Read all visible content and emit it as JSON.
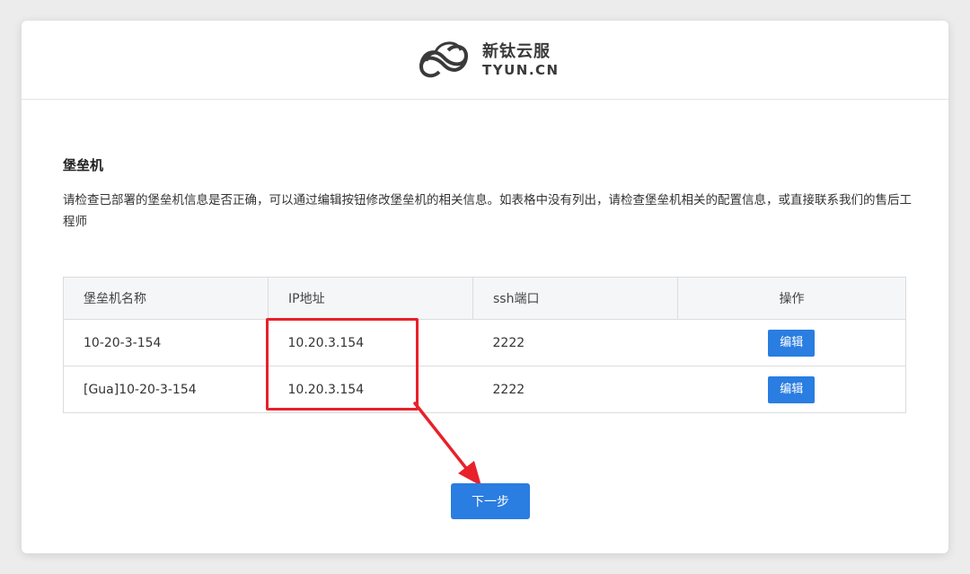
{
  "brand": {
    "name_cn": "新钛云服",
    "name_en": "TYUN.CN",
    "logo_icon": "infinity-cloud-logo-icon"
  },
  "section": {
    "title": "堡垒机",
    "description": "请检查已部署的堡垒机信息是否正确，可以通过编辑按钮修改堡垒机的相关信息。如表格中没有列出，请检查堡垒机相关的配置信息，或直接联系我们的售后工程师"
  },
  "table": {
    "headers": [
      "堡垒机名称",
      "IP地址",
      "ssh端口",
      "操作"
    ],
    "rows": [
      {
        "name": "10-20-3-154",
        "ip": "10.20.3.154",
        "port": "2222",
        "action": "编辑"
      },
      {
        "name": "[Gua]10-20-3-154",
        "ip": "10.20.3.154",
        "port": "2222",
        "action": "编辑"
      }
    ]
  },
  "next_button": {
    "label": "下一步"
  },
  "colors": {
    "primary": "#2a7de1",
    "annotation": "#e8212a"
  }
}
